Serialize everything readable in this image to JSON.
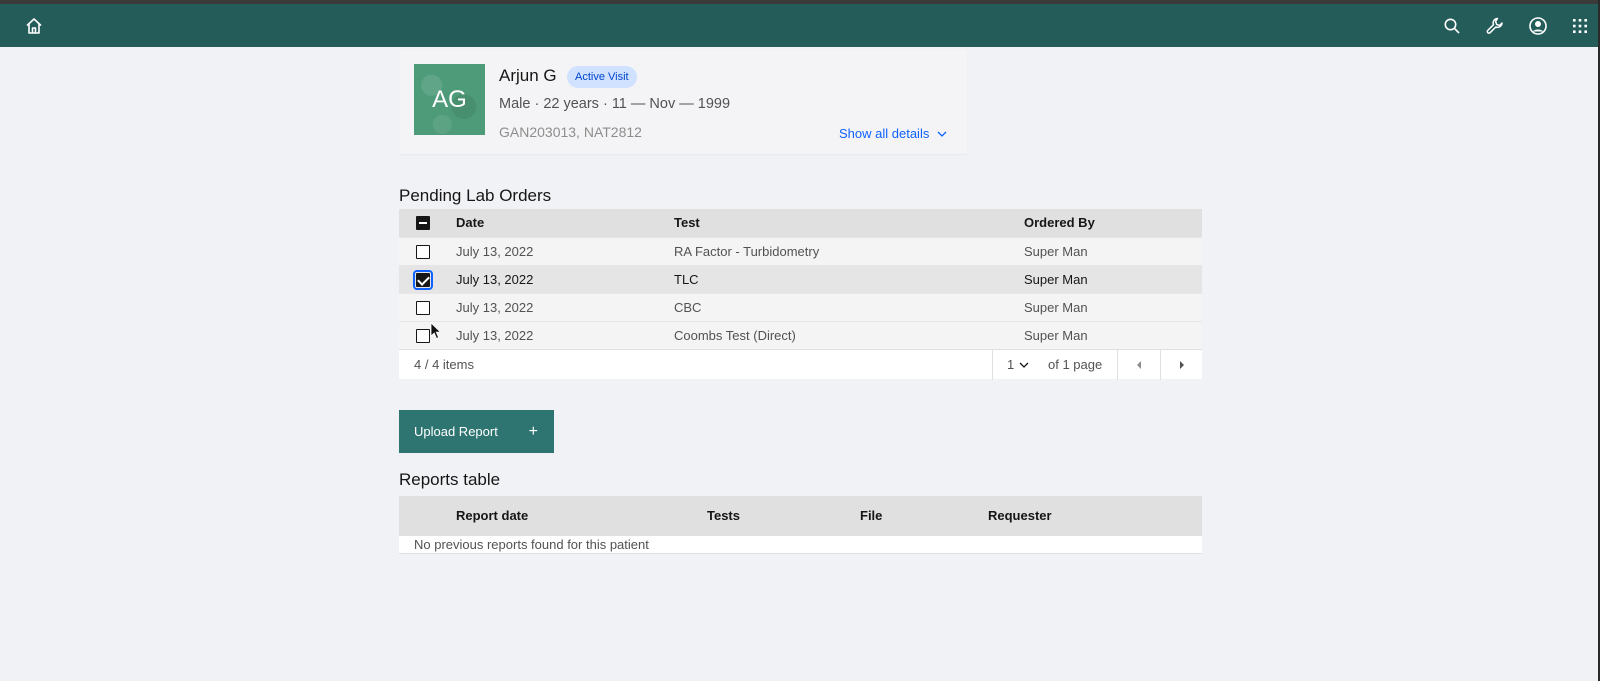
{
  "header": {
    "icons": {
      "home": "home-icon",
      "search": "search-icon",
      "admin": "wrench-icon",
      "user": "user-avatar-icon",
      "apps": "app-switcher-icon"
    },
    "colors": {
      "bar": "#245c5a",
      "accent": "#0f62fe"
    }
  },
  "patient": {
    "initials": "AG",
    "name": "Arjun G",
    "badge": "Active Visit",
    "demographics": "Male · 22 years · 11 — Nov — 1999",
    "identifiers": "GAN203013, NAT2812",
    "show_all": "Show all details"
  },
  "pending_orders": {
    "title": "Pending Lab Orders",
    "header_checkbox": "indeterminate",
    "columns": [
      "Date",
      "Test",
      "Ordered By"
    ],
    "rows": [
      {
        "date": "July 13, 2022",
        "test": "RA Factor - Turbidometry",
        "ordered_by": "Super Man",
        "checked": false
      },
      {
        "date": "July 13, 2022",
        "test": "TLC",
        "ordered_by": "Super Man",
        "checked": true
      },
      {
        "date": "July 13, 2022",
        "test": "CBC",
        "ordered_by": "Super Man",
        "checked": false
      },
      {
        "date": "July 13, 2022",
        "test": "Coombs Test (Direct)",
        "ordered_by": "Super Man",
        "checked": false
      }
    ],
    "pagination": {
      "items": "4 / 4 items",
      "page": "1",
      "of_pages": "of 1 page"
    }
  },
  "upload": {
    "label": "Upload Report",
    "plus": "+"
  },
  "reports": {
    "title": "Reports table",
    "columns": [
      "Report date",
      "Tests",
      "File",
      "Requester"
    ],
    "empty_message": "No previous reports found for this patient"
  }
}
